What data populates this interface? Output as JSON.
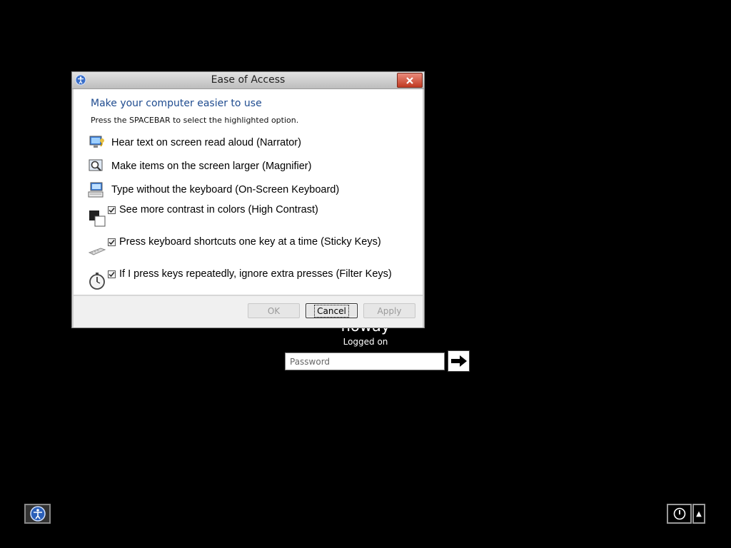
{
  "logon": {
    "username": "noway",
    "status": "Logged on",
    "password_placeholder": "Password"
  },
  "dialog": {
    "title": "Ease of Access",
    "heading": "Make your computer easier to use",
    "instruction": "Press the SPACEBAR to select the highlighted option.",
    "options": [
      {
        "label": "Hear text on screen read aloud (Narrator)",
        "icon": "narrator-icon"
      },
      {
        "label": "Make items on the screen larger (Magnifier)",
        "icon": "magnifier-icon"
      },
      {
        "label": "Type without the keyboard (On-Screen Keyboard)",
        "icon": "keyboard-icon"
      }
    ],
    "checkboxes": [
      {
        "label": "See more contrast in colors (High Contrast)",
        "checked": true,
        "icon": "high-contrast-icon"
      },
      {
        "label": "Press keyboard shortcuts one key at a time (Sticky Keys)",
        "checked": true,
        "icon": "sticky-keys-icon"
      },
      {
        "label": "If I press keys repeatedly, ignore extra presses (Filter Keys)",
        "checked": true,
        "icon": "filter-keys-icon"
      }
    ],
    "buttons": {
      "ok": "OK",
      "cancel": "Cancel",
      "apply": "Apply"
    }
  },
  "colors": {
    "heading": "#1e4b8f",
    "close_button": "#c13a22",
    "background": "#000000"
  }
}
